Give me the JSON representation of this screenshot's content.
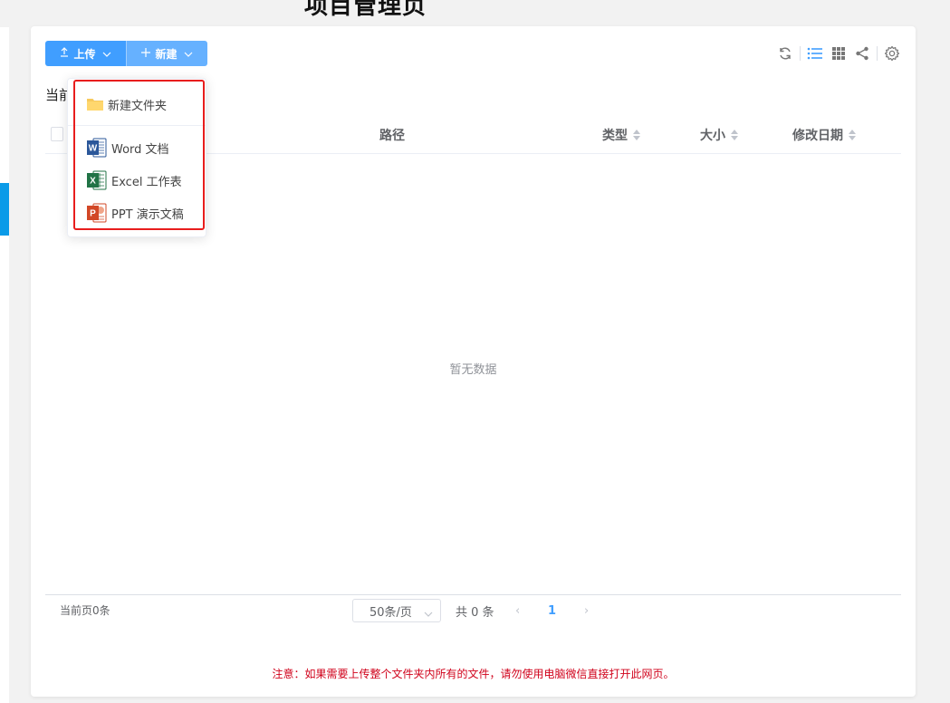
{
  "page": {
    "title": "项目管理页"
  },
  "toolbar": {
    "upload_label": "上传",
    "new_label": "新建",
    "upload_icon": "upload-arrow-icon",
    "new_icon": "plus-icon",
    "right_icons": [
      "refresh-icon",
      "list-view-icon",
      "grid-view-icon",
      "share-icon",
      "settings-icon"
    ]
  },
  "location": {
    "label": "当前"
  },
  "table": {
    "columns": [
      "路径",
      "类型",
      "大小",
      "修改日期"
    ],
    "empty_text": "暂无数据"
  },
  "dropdown": {
    "items": [
      {
        "label": "新建文件夹",
        "icon": "folder-icon"
      },
      {
        "label": "Word 文档",
        "icon": "word-icon"
      },
      {
        "label": "Excel 工作表",
        "icon": "excel-icon"
      },
      {
        "label": "PPT 演示文稿",
        "icon": "ppt-icon"
      }
    ]
  },
  "footer": {
    "page_count": "当前页0条",
    "page_size": "50条/页",
    "total": "共 0 条",
    "current_page": "1",
    "prev": "‹",
    "next": "›"
  },
  "notice": "注意：如果需要上传整个文件夹内所有的文件，请勿使用电脑微信直接打开此网页。",
  "colors": {
    "primary": "#409eff",
    "primary_light": "#66b1ff",
    "notice_red": "#d0021b",
    "highlight_red": "#e81d1d"
  }
}
